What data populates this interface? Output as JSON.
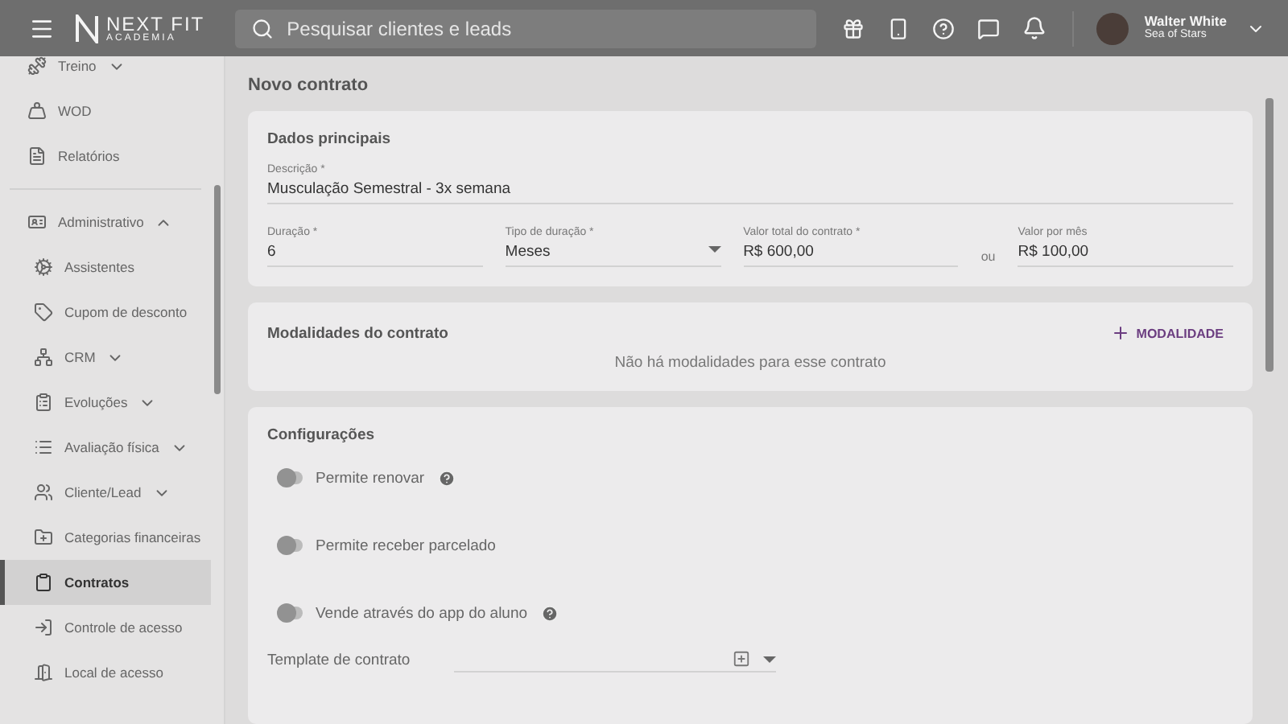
{
  "topbar": {
    "logo_title": "NEXT FIT",
    "logo_subtitle": "ACADEMIA",
    "search": {
      "placeholder": "Pesquisar clientes e leads"
    },
    "user": {
      "name": "Walter White",
      "subtitle": "Sea of Stars"
    }
  },
  "sidebar": {
    "items": [
      {
        "label": "Treino",
        "expanded": false,
        "selected": false
      },
      {
        "label": "WOD",
        "selected": false
      },
      {
        "label": "Relatórios",
        "selected": false
      },
      {
        "label": "Administrativo",
        "expanded": true,
        "selected": false,
        "children": [
          {
            "label": "Assistentes",
            "selected": false
          },
          {
            "label": "Cupom de desconto",
            "selected": false
          },
          {
            "label": "CRM",
            "expanded": false,
            "selected": false
          },
          {
            "label": "Evoluções",
            "expanded": false,
            "selected": false
          },
          {
            "label": "Avaliação física",
            "expanded": false,
            "selected": false
          },
          {
            "label": "Cliente/Lead",
            "expanded": false,
            "selected": false
          },
          {
            "label": "Categorias financeiras",
            "selected": false
          },
          {
            "label": "Contratos",
            "selected": true
          },
          {
            "label": "Controle de acesso",
            "selected": false
          },
          {
            "label": "Local de acesso",
            "selected": false
          }
        ]
      }
    ]
  },
  "page": {
    "title": "Novo contrato",
    "main": {
      "title": "Dados principais",
      "description": {
        "label": "Descrição *",
        "value": "Musculação Semestral - 3x semana"
      },
      "fields": [
        {
          "label": "Duração *",
          "value": "6",
          "kind": "text"
        },
        {
          "label": "Tipo de duração *",
          "value": "Meses",
          "kind": "select"
        },
        {
          "label": "Valor total do contrato *",
          "value": "R$ 600,00",
          "kind": "text"
        },
        {
          "label": "Valor por mês",
          "value": "R$ 100,00",
          "kind": "text"
        }
      ],
      "separator": "ou"
    },
    "modalities": {
      "title": "Modalidades do contrato",
      "add_button": "MODALIDADE",
      "empty": "Não há modalidades para esse contrato"
    },
    "config": {
      "title": "Configurações",
      "options": [
        {
          "label": "Permite renovar",
          "on": false,
          "help": true
        },
        {
          "label": "Permite receber parcelado",
          "on": false,
          "help": false
        },
        {
          "label": "Vende através do app do aluno",
          "on": false,
          "help": true
        }
      ],
      "template": {
        "label": "Template de contrato"
      }
    }
  }
}
